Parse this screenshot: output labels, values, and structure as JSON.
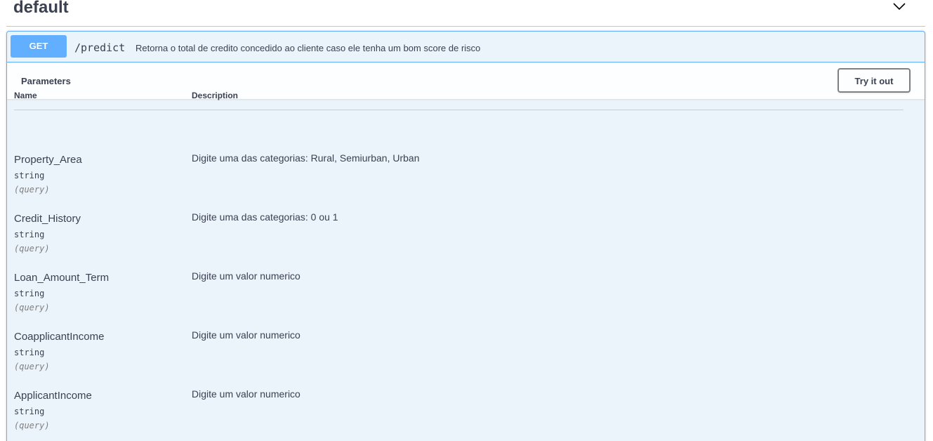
{
  "tag": {
    "title": "default",
    "toggle_icon": "chevron-down-icon"
  },
  "operation": {
    "method": "GET",
    "path": "/predict",
    "summary": "Retorna o total de credito concedido ao cliente caso ele tenha um bom score de risco",
    "colors": {
      "method_bg": "#61affe",
      "block_bg": "#ebf3fb",
      "border": "#61affe"
    }
  },
  "parameters_section": {
    "title": "Parameters",
    "try_button": "Try it out",
    "columns": {
      "name": "Name",
      "description": "Description"
    },
    "rows": [
      {
        "name": "Property_Area",
        "type": "string",
        "in": "(query)",
        "description": "Digite uma das categorias: Rural, Semiurban, Urban"
      },
      {
        "name": "Credit_History",
        "type": "string",
        "in": "(query)",
        "description": "Digite uma das categorias: 0 ou 1"
      },
      {
        "name": "Loan_Amount_Term",
        "type": "string",
        "in": "(query)",
        "description": "Digite um valor numerico"
      },
      {
        "name": "CoapplicantIncome",
        "type": "string",
        "in": "(query)",
        "description": "Digite um valor numerico"
      },
      {
        "name": "ApplicantIncome",
        "type": "string",
        "in": "(query)",
        "description": "Digite um valor numerico"
      }
    ]
  }
}
